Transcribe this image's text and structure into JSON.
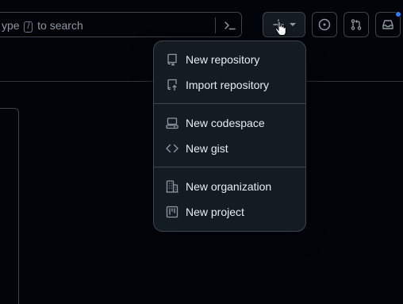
{
  "search": {
    "placeholder_text": "ype",
    "kbd": "/",
    "placeholder_suffix": "to search"
  },
  "header": {
    "new_button_icon": "plus-icon",
    "issues_icon": "issue-opened-icon",
    "prs_icon": "git-pull-request-icon",
    "inbox_icon": "inbox-icon",
    "notification_color": "#2f81f7"
  },
  "menu": {
    "groups": [
      [
        {
          "label": "New repository",
          "icon": "repo-icon"
        },
        {
          "label": "Import repository",
          "icon": "repo-push-icon"
        }
      ],
      [
        {
          "label": "New codespace",
          "icon": "codespaces-icon"
        },
        {
          "label": "New gist",
          "icon": "code-icon"
        }
      ],
      [
        {
          "label": "New organization",
          "icon": "organization-icon"
        },
        {
          "label": "New project",
          "icon": "project-icon"
        }
      ]
    ]
  }
}
